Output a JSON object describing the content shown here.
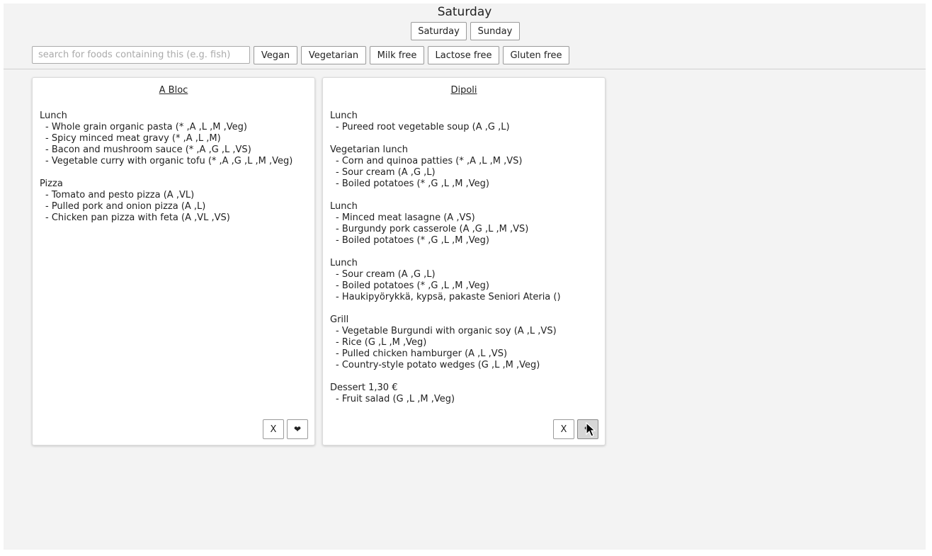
{
  "header": {
    "day_title": "Saturday",
    "day_buttons": [
      "Saturday",
      "Sunday"
    ]
  },
  "filters": {
    "search_placeholder": "search for foods containing this (e.g. fish)",
    "buttons": [
      "Vegan",
      "Vegetarian",
      "Milk free",
      "Lactose free",
      "Gluten free"
    ]
  },
  "restaurants": [
    {
      "name": "A Bloc",
      "sections": [
        {
          "title": "Lunch",
          "items": [
            "- Whole grain organic pasta (* ,A ,L ,M ,Veg)",
            "- Spicy minced meat gravy (* ,A ,L ,M)",
            "- Bacon and mushroom sauce (* ,A ,G ,L ,VS)",
            "- Vegetable curry with organic tofu (* ,A ,G ,L ,M ,Veg)"
          ]
        },
        {
          "title": "Pizza",
          "items": [
            "- Tomato and pesto pizza (A ,VL)",
            "- Pulled pork and onion pizza (A ,L)",
            "- Chicken pan pizza with feta (A ,VL ,VS)"
          ]
        }
      ],
      "hide_label": "X",
      "favorite_icon": "heart-icon",
      "favorite_glyph": "❤"
    },
    {
      "name": "Dipoli",
      "sections": [
        {
          "title": "Lunch",
          "items": [
            "- Pureed root vegetable soup (A ,G ,L)"
          ]
        },
        {
          "title": "Vegetarian lunch",
          "items": [
            "- Corn and quinoa patties (* ,A ,L ,M ,VS)",
            "- Sour cream (A ,G ,L)",
            "- Boiled potatoes (* ,G ,L ,M ,Veg)"
          ]
        },
        {
          "title": "Lunch",
          "items": [
            "- Minced meat lasagne (A ,VS)",
            "- Burgundy pork casserole (A ,G ,L ,M ,VS)",
            "- Boiled potatoes (* ,G ,L ,M ,Veg)"
          ]
        },
        {
          "title": "Lunch",
          "items": [
            "- Sour cream (A ,G ,L)",
            "- Boiled potatoes (* ,G ,L ,M ,Veg)",
            "- Haukipyörykkä, kypsä, pakaste Seniori Ateria ()"
          ]
        },
        {
          "title": "Grill",
          "items": [
            "- Vegetable Burgundi with organic soy (A ,L ,VS)",
            "- Rice (G ,L ,M ,Veg)",
            "- Pulled chicken hamburger (A ,L ,VS)",
            "- Country-style potato wedges (G ,L ,M ,Veg)"
          ]
        },
        {
          "title": "Dessert 1,30 €",
          "items": [
            "- Fruit salad (G ,L ,M ,Veg)"
          ]
        }
      ],
      "hide_label": "X",
      "favorite_icon": "heart-icon",
      "favorite_glyph": "❤"
    }
  ],
  "colors": {
    "page_background": "#f3f3f3",
    "card_background": "#ffffff",
    "text": "#222222",
    "button_border": "#9a9a9a",
    "pressed_button": "#d6d6d6"
  }
}
